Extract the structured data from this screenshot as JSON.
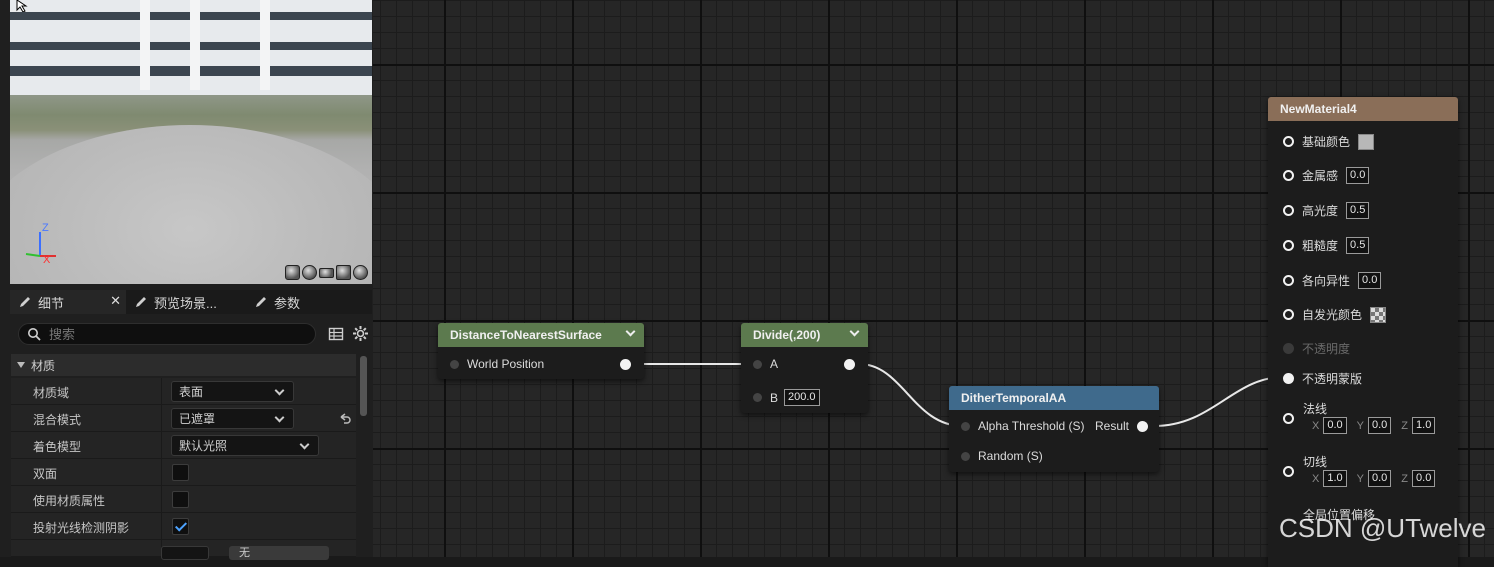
{
  "left_panel": {
    "viewport": {
      "axis_z": "Z",
      "axis_x": "X"
    },
    "tabs": [
      {
        "label": "细节",
        "active": true
      },
      {
        "label": "预览场景..."
      },
      {
        "label": "参数"
      }
    ],
    "search": {
      "placeholder": "搜索"
    },
    "section_title": "材质",
    "properties": [
      {
        "label": "材质域",
        "value": "表面"
      },
      {
        "label": "混合模式",
        "value": "已遮罩"
      },
      {
        "label": "着色模型",
        "value": "默认光照"
      },
      {
        "label": "双面",
        "checked": false
      },
      {
        "label": "使用材质属性",
        "checked": false
      },
      {
        "label": "投射光线检测阴影",
        "checked": true
      }
    ],
    "partial_dropdown": "无"
  },
  "graph": {
    "nodes": {
      "distance": {
        "title": "DistanceToNearestSurface",
        "input": "World Position",
        "header_color": "#5c7a4e"
      },
      "divide": {
        "title": "Divide(,200)",
        "input_a": "A",
        "input_b": "B",
        "b_value": "200.0",
        "header_color": "#5c7a4e"
      },
      "dither": {
        "title": "DitherTemporalAA",
        "input_1": "Alpha Threshold (S)",
        "output": "Result",
        "input_2": "Random (S)",
        "header_color": "#3f6a8c"
      },
      "material": {
        "title": "NewMaterial4",
        "header_color": "#8a6e58",
        "base_color_label": "基础颜色",
        "metallic_label": "金属感",
        "metallic_value": "0.0",
        "specular_label": "高光度",
        "specular_value": "0.5",
        "roughness_label": "粗糙度",
        "roughness_value": "0.5",
        "anisotropy_label": "各向异性",
        "anisotropy_value": "0.0",
        "emissive_label": "自发光颜色",
        "opacity_label": "不透明度",
        "opacity_mask_label": "不透明蒙版",
        "normal_label": "法线",
        "normal": {
          "x": "0.0",
          "y": "0.0",
          "z": "1.0"
        },
        "tangent_label": "切线",
        "tangent": {
          "x": "1.0",
          "y": "0.0",
          "z": "0.0"
        },
        "wpo_label": "全局位置偏移",
        "axis_x": "X",
        "axis_y": "Y",
        "axis_z": "Z"
      }
    }
  },
  "watermark": "CSDN @UTwelve"
}
